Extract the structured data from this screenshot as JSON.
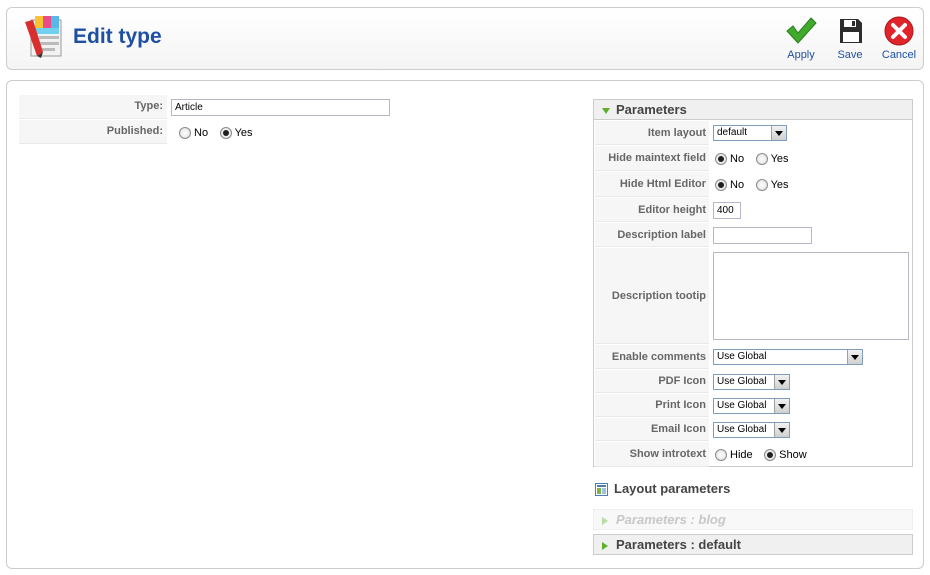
{
  "toolbar": {
    "title": "Edit type",
    "apply_label": "Apply",
    "save_label": "Save",
    "cancel_label": "Cancel"
  },
  "form": {
    "type_label": "Type:",
    "type_value": "Article",
    "published_label": "Published:",
    "published_no": "No",
    "published_yes": "Yes",
    "published_selected": "Yes"
  },
  "parameters": {
    "header": "Parameters",
    "item_layout": {
      "label": "Item layout",
      "value": "default"
    },
    "hide_maintext": {
      "label": "Hide maintext field",
      "no": "No",
      "yes": "Yes",
      "selected": "No"
    },
    "hide_html_editor": {
      "label": "Hide Html Editor",
      "no": "No",
      "yes": "Yes",
      "selected": "No"
    },
    "editor_height": {
      "label": "Editor height",
      "value": "400"
    },
    "description_label": {
      "label": "Description label",
      "value": ""
    },
    "description_tooltip": {
      "label": "Description tootip",
      "value": ""
    },
    "enable_comments": {
      "label": "Enable comments",
      "value": "Use Global"
    },
    "pdf_icon": {
      "label": "PDF Icon",
      "value": "Use Global"
    },
    "print_icon": {
      "label": "Print Icon",
      "value": "Use Global"
    },
    "email_icon": {
      "label": "Email Icon",
      "value": "Use Global"
    },
    "show_introtext": {
      "label": "Show introtext",
      "hide": "Hide",
      "show": "Show",
      "selected": "Show"
    }
  },
  "layout_parameters": {
    "title": "Layout parameters",
    "blog_panel": "Parameters : blog",
    "default_panel": "Parameters : default"
  },
  "colors": {
    "title_blue": "#1d4fa3",
    "accent_green": "#5fae2c",
    "cancel_red": "#e0242a"
  }
}
